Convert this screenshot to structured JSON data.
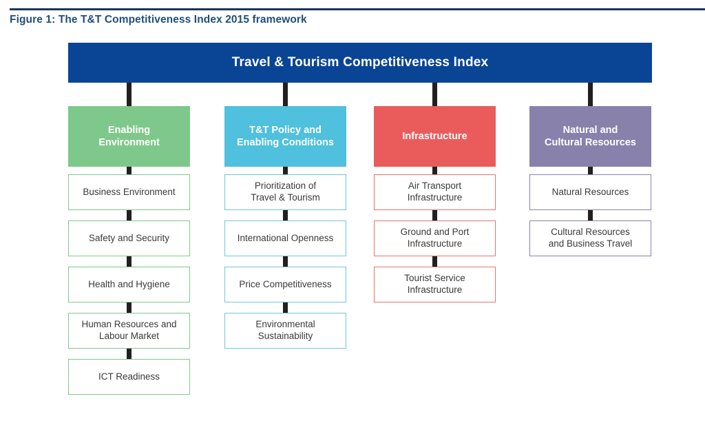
{
  "figure": {
    "caption": "Figure 1: The T&T Competitiveness Index 2015 framework",
    "rule_color": "#17365d",
    "caption_color": "#1f4e79"
  },
  "index": {
    "label": "Travel & Tourism Competitiveness Index",
    "color": "#0a4595"
  },
  "connector_color": "#231f20",
  "pillars": [
    {
      "id": "enabling-environment",
      "label": "Enabling\nEnvironment",
      "color": "#7fc88b",
      "border_color": "#7fc88b",
      "subindexes": [
        "Business Environment",
        "Safety and Security",
        "Health and Hygiene",
        "Human Resources and\nLabour Market",
        "ICT Readiness"
      ]
    },
    {
      "id": "tt-policy-and-enabling-conditions",
      "label": "T&T Policy and\nEnabling Conditions",
      "color": "#4fc0dd",
      "border_color": "#6ec6e0",
      "subindexes": [
        "Prioritization of\nTravel & Tourism",
        "International Openness",
        "Price Competitiveness",
        "Environmental\nSustainability"
      ]
    },
    {
      "id": "infrastructure",
      "label": "Infrastructure",
      "color": "#ea5c5c",
      "border_color": "#e8736f",
      "subindexes": [
        "Air Transport\nInfrastructure",
        "Ground and Port\nInfrastructure",
        "Tourist Service\nInfrastructure"
      ]
    },
    {
      "id": "natural-and-cultural-resources",
      "label": "Natural and\nCultural Resources",
      "color": "#8781ab",
      "border_color": "#8781ab",
      "subindexes": [
        "Natural Resources",
        "Cultural Resources\nand Business Travel"
      ]
    }
  ]
}
